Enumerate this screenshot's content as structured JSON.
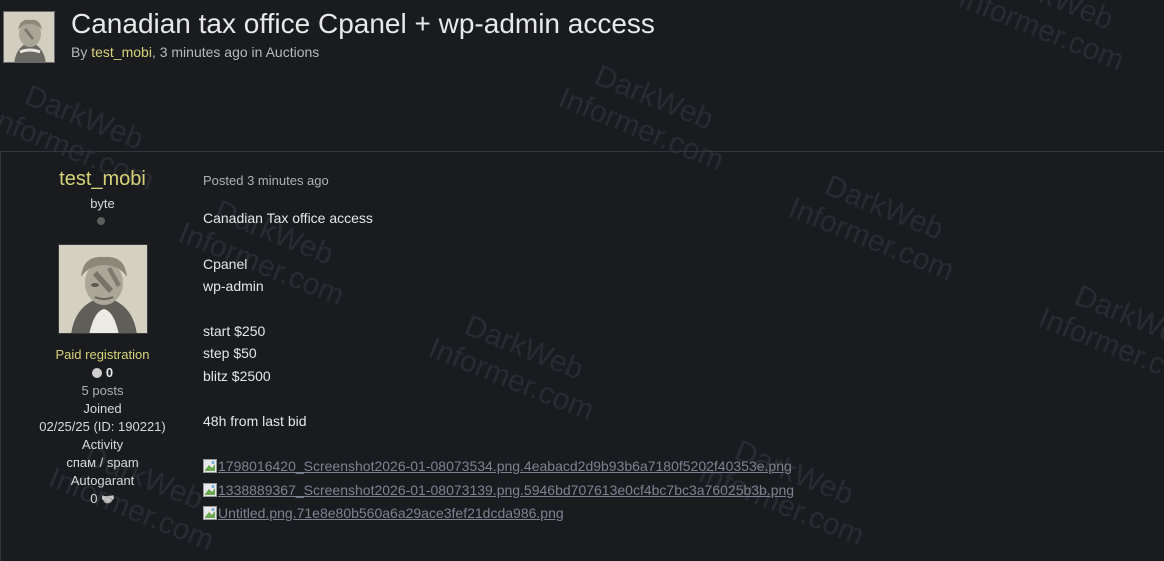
{
  "topic": {
    "title": "Canadian tax office Cpanel + wp-admin access",
    "by_prefix": "By ",
    "author": "test_mobi",
    "time_text": ", 3 minutes ago in ",
    "category": "Auctions"
  },
  "author_panel": {
    "username": "test_mobi",
    "rank": "byte",
    "group": "Paid registration",
    "reputation": "0",
    "posts": "5 posts",
    "joined_label": "Joined",
    "joined_value": "02/25/25 (ID: 190221)",
    "activity_label": "Activity",
    "activity_value": "спам / spam",
    "autogarant_label": "Autogarant",
    "autogarant_value": "0",
    "handshake_glyph": "🤝"
  },
  "post": {
    "posted": "Posted 3 minutes ago",
    "lines": [
      "Canadian Tax office access",
      "Cpanel",
      "wp-admin",
      "start $250",
      "step $50",
      "blitz $2500",
      "48h from last bid"
    ],
    "attachments": [
      "1798016420_Screenshot2026-01-08073534.png.4eabacd2d9b93b6a7180f5202f40353e.png",
      "1338889367_Screenshot2026-01-08073139.png.5946bd707613e0cf4bc7bc3a76025b3b.png",
      "Untitled.png.71e8e80b560a6a29ace3fef21dcda986.png"
    ]
  },
  "watermark": {
    "line1": "DarkWeb",
    "line2": "Informer.com"
  },
  "colors": {
    "background": "#1a1b1f",
    "accent": "#d6d27a",
    "link": "#7b8390"
  }
}
